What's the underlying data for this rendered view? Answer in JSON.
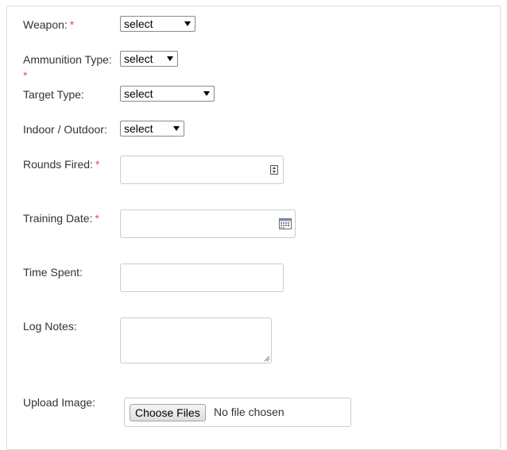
{
  "form": {
    "required_marker": "*",
    "weapon": {
      "label": "Weapon:",
      "required": true,
      "value": "select"
    },
    "ammunition_type": {
      "label": "Ammunition Type:",
      "required": true,
      "value": "select"
    },
    "target_type": {
      "label": "Target Type:",
      "required": false,
      "value": "select"
    },
    "indoor_outdoor": {
      "label": "Indoor / Outdoor:",
      "required": false,
      "value": "select"
    },
    "rounds_fired": {
      "label": "Rounds Fired:",
      "required": true,
      "value": ""
    },
    "training_date": {
      "label": "Training Date:",
      "required": true,
      "value": ""
    },
    "time_spent": {
      "label": "Time Spent:",
      "required": false,
      "value": ""
    },
    "log_notes": {
      "label": "Log Notes:",
      "required": false,
      "value": ""
    },
    "upload_image": {
      "label": "Upload Image:",
      "button_label": "Choose Files",
      "status_text": "No file chosen"
    }
  },
  "colors": {
    "required": "#d9534f",
    "label": "#333333",
    "border": "#cccccc"
  },
  "icons": {
    "rounds_fired": "number-spinner-icon",
    "training_date": "calendar-icon",
    "log_notes": "resize-handle-icon"
  }
}
